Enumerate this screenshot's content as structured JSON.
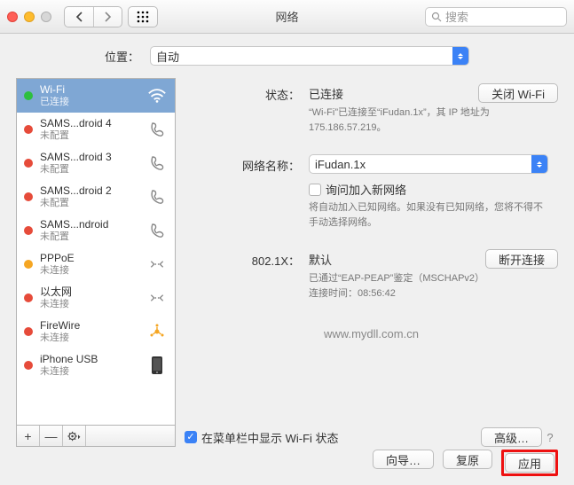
{
  "toolbar": {
    "title": "网络",
    "search_placeholder": "搜索"
  },
  "location": {
    "label": "位置：",
    "value": "自动"
  },
  "sidebar": {
    "items": [
      {
        "name": "Wi-Fi",
        "sub": "已连接",
        "dot": "green",
        "icon": "wifi",
        "selected": true
      },
      {
        "name": "SAMS...droid 4",
        "sub": "未配置",
        "dot": "red",
        "icon": "phone"
      },
      {
        "name": "SAMS...droid 3",
        "sub": "未配置",
        "dot": "red",
        "icon": "phone"
      },
      {
        "name": "SAMS...droid 2",
        "sub": "未配置",
        "dot": "red",
        "icon": "phone"
      },
      {
        "name": "SAMS...ndroid",
        "sub": "未配置",
        "dot": "red",
        "icon": "phone"
      },
      {
        "name": "PPPoE",
        "sub": "未连接",
        "dot": "amber",
        "icon": "ethernet"
      },
      {
        "name": "以太网",
        "sub": "未连接",
        "dot": "red",
        "icon": "ethernet"
      },
      {
        "name": "FireWire",
        "sub": "未连接",
        "dot": "red",
        "icon": "firewire"
      },
      {
        "name": "iPhone USB",
        "sub": "未连接",
        "dot": "red",
        "icon": "iphone"
      }
    ],
    "foot": {
      "add": "+",
      "remove": "—",
      "gear": ""
    }
  },
  "detail": {
    "status_label": "状态：",
    "status_value": "已连接",
    "wifi_off_btn": "关闭 Wi-Fi",
    "status_desc": "“Wi-Fi”已连接至“iFudan.1x”，其 IP 地址为 175.186.57.219。",
    "network_label": "网络名称：",
    "network_value": "iFudan.1x",
    "ask_join_label": "询问加入新网络",
    "ask_join_desc": "将自动加入已知网络。如果没有已知网络，您将不得不手动选择网络。",
    "dot1x_label": "802.1X：",
    "dot1x_value": "默认",
    "disconnect_btn": "断开连接",
    "dot1x_desc1": "已通过“EAP-PEAP”鉴定（MSCHAPv2）",
    "dot1x_desc2": "连接时间：08:56:42",
    "site": "www.mydll.com.cn",
    "menubar_check": "在菜单栏中显示 Wi-Fi 状态",
    "advanced_btn": "高级…"
  },
  "bottom": {
    "wizard": "向导…",
    "revert": "复原",
    "apply": "应用"
  }
}
